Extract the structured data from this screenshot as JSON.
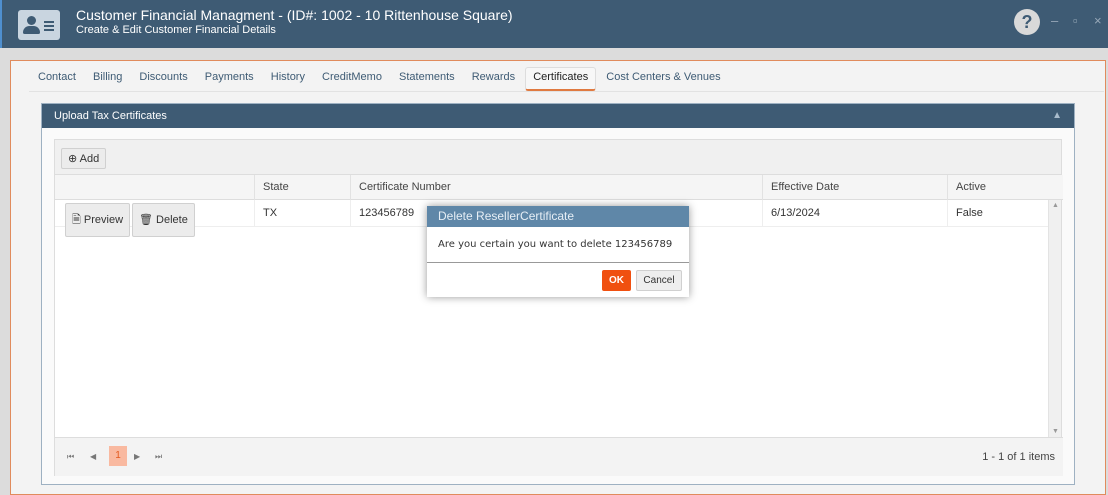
{
  "window": {
    "title": "Customer Financial Managment - (ID#: 1002 - 10 Rittenhouse Square)",
    "subtitle": "Create & Edit Customer Financial Details",
    "help_label": "?",
    "minimize_label": "–",
    "maximize_label": "▫",
    "close_label": "×"
  },
  "tabs": [
    {
      "label": "Contact"
    },
    {
      "label": "Billing"
    },
    {
      "label": "Discounts"
    },
    {
      "label": "Payments"
    },
    {
      "label": "History"
    },
    {
      "label": "CreditMemo"
    },
    {
      "label": "Statements"
    },
    {
      "label": "Rewards"
    },
    {
      "label": "Certificates",
      "active": true
    },
    {
      "label": "Cost Centers & Venues"
    }
  ],
  "panel": {
    "title": "Upload Tax Certificates",
    "collapse_icon": "chevron-up-icon"
  },
  "grid": {
    "add_label": "Add",
    "columns": [
      "",
      "State",
      "Certificate Number",
      "Effective Date",
      "Active"
    ],
    "rows": [
      {
        "preview_label": "Preview",
        "delete_label": "Delete",
        "state": "TX",
        "certificate_number": "123456789",
        "effective_date": "6/13/2024",
        "active": "False"
      }
    ],
    "pager": {
      "current_page": "1",
      "info": "1 - 1 of 1 items"
    }
  },
  "dialog": {
    "title": "Delete ResellerCertificate",
    "message": "Are you certain you want to delete 123456789",
    "ok_label": "OK",
    "cancel_label": "Cancel"
  },
  "colors": {
    "titlebar": "#3e5b74",
    "accent": "#f05010",
    "dialog_header": "#5f87a8"
  }
}
